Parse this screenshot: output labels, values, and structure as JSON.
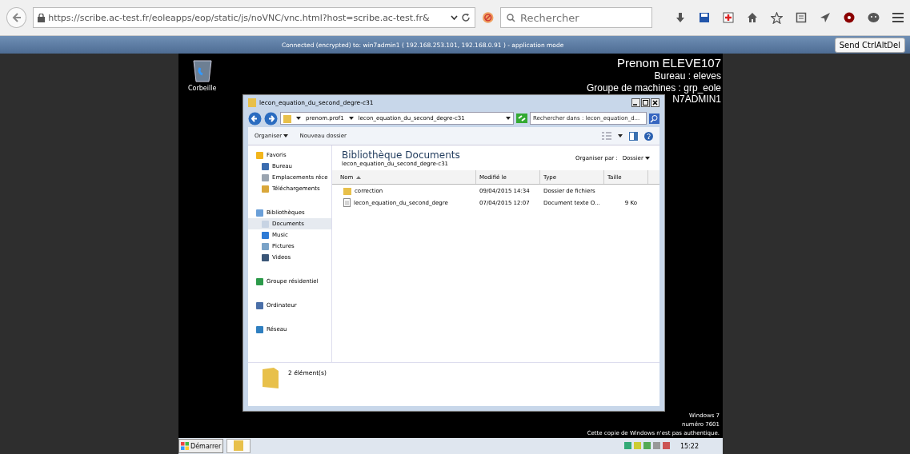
{
  "browser": {
    "url": "https://scribe.ac-test.fr/eoleapps/eop/static/js/noVNC/vnc.html?host=scribe.ac-test.fr&",
    "search_placeholder": "Rechercher"
  },
  "vnc": {
    "status": "Connected (encrypted) to: win7admin1 ( 192.168.253.101, 192.168.0.91 ) - application mode",
    "send_button": "Send CtrlAltDel"
  },
  "desktop": {
    "recycle_bin": "Corbeille",
    "info": [
      "Prenom ELEVE107",
      "Bureau : eleves",
      "Groupe de machines : grp_eole",
      "N7ADMIN1"
    ],
    "watermark": [
      "Windows 7",
      "numéro 7601",
      "Cette copie de Windows n'est pas authentique."
    ]
  },
  "explorer": {
    "title": "lecon_equation_du_second_degre-c31",
    "breadcrumb": [
      "prenom.prof1",
      "lecon_equation_du_second_degre-c31"
    ],
    "search_placeholder": "Rechercher dans : lecon_equation_d...",
    "toolbar": [
      "Organiser",
      "Nouveau dossier"
    ],
    "nav": [
      {
        "label": "Favoris",
        "selected": false,
        "children": [
          {
            "label": "Bureau",
            "selected": false
          },
          {
            "label": "Emplacements réce",
            "selected": false
          },
          {
            "label": "Téléchargements",
            "selected": false
          }
        ]
      },
      {
        "label": "Bibliothèques",
        "selected": false,
        "children": [
          {
            "label": "Documents",
            "selected": true
          },
          {
            "label": "Music",
            "selected": false
          },
          {
            "label": "Pictures",
            "selected": false
          },
          {
            "label": "Videos",
            "selected": false
          }
        ]
      },
      {
        "label": "Groupe résidentiel",
        "selected": false
      },
      {
        "label": "Ordinateur",
        "selected": false
      },
      {
        "label": "Réseau",
        "selected": false
      }
    ],
    "library_title": "Bibliothèque Documents",
    "library_subtitle": "lecon_equation_du_second_degre-c31",
    "arrange_label": "Organiser par :",
    "arrange_value": "Dossier",
    "columns": [
      "Nom",
      "Modifié le",
      "Type",
      "Taille"
    ],
    "rows": [
      {
        "kind": "folder",
        "name": "correction",
        "modified": "09/04/2015 14:34",
        "type": "Dossier de fichiers"
      },
      {
        "kind": "file",
        "name": "lecon_equation_du_second_degre",
        "modified": "07/04/2015 12:07",
        "type": "Document texte O...",
        "size": "9 Ko"
      }
    ],
    "status": "2 élément(s)"
  },
  "taskbar": {
    "start": "Démarrer",
    "clock": "15:22"
  }
}
